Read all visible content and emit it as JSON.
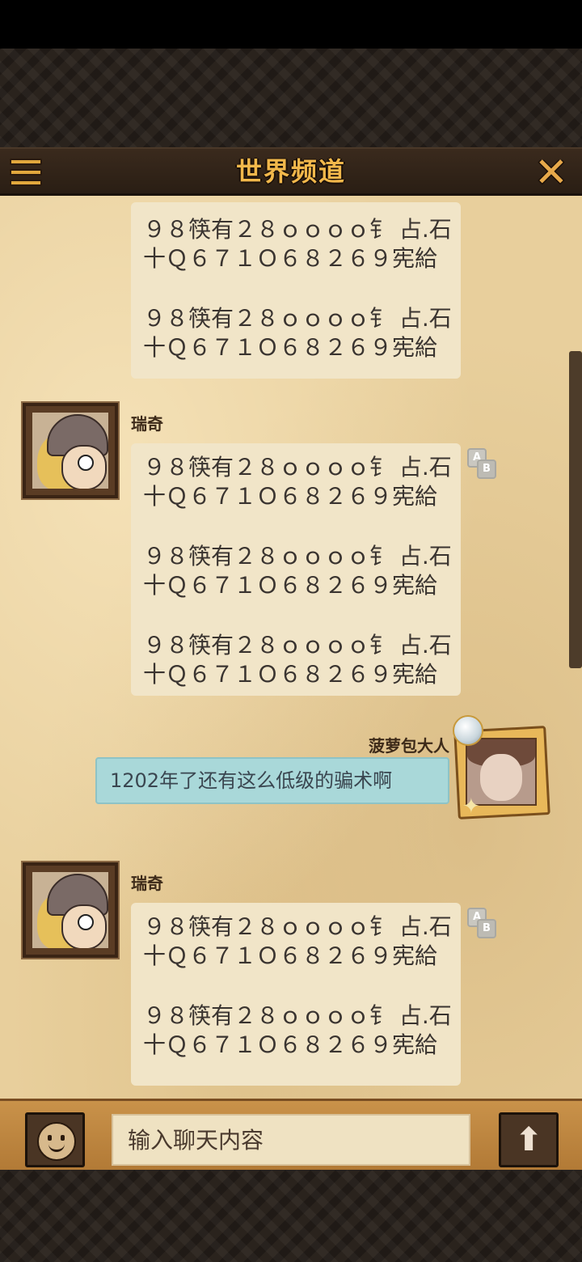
{
  "header": {
    "title": "世界频道"
  },
  "messages": [
    {
      "sender": "",
      "lines": [
        "９８筷有２８ｏｏｏｏ钅 占.石",
        "十Ｑ６７１Ｏ６８２６９宪給",
        "",
        "９８筷有２８ｏｏｏｏ钅 占.石",
        "十Ｑ６７１Ｏ６８２６９宪給"
      ]
    },
    {
      "sender": "瑞奇",
      "lines": [
        "９８筷有２８ｏｏｏｏ钅 占.石",
        "十Ｑ６７１Ｏ６８２６９宪給",
        "",
        "９８筷有２８ｏｏｏｏ钅 占.石",
        "十Ｑ６７１Ｏ６８２６９宪給",
        "",
        "９８筷有２８ｏｏｏｏ钅 占.石",
        "十Ｑ６７１Ｏ６８２６９宪給"
      ]
    },
    {
      "sender": "菠萝包大人",
      "text": "1202年了还有这么低级的骗术啊"
    },
    {
      "sender": "瑞奇",
      "lines": [
        "９８筷有２８ｏｏｏｏ钅 占.石",
        "十Ｑ６７１Ｏ６８２６９宪給",
        "",
        "９８筷有２８ｏｏｏｏ钅 占.石",
        "十Ｑ６７１Ｏ６８２６９宪給"
      ]
    }
  ],
  "translate_icon": {
    "a": "A",
    "b": "B"
  },
  "input": {
    "placeholder": "输入聊天内容"
  },
  "icons": {
    "menu": "menu-icon",
    "close": "close-icon",
    "emoji": "emoji-icon",
    "send": "send-arrow-icon",
    "translate": "translate-icon"
  },
  "colors": {
    "title": "#f2b84b",
    "my_bubble": "#a9d8d9",
    "bubble": "#f1e5c8",
    "paper": "#e8cf9c"
  }
}
